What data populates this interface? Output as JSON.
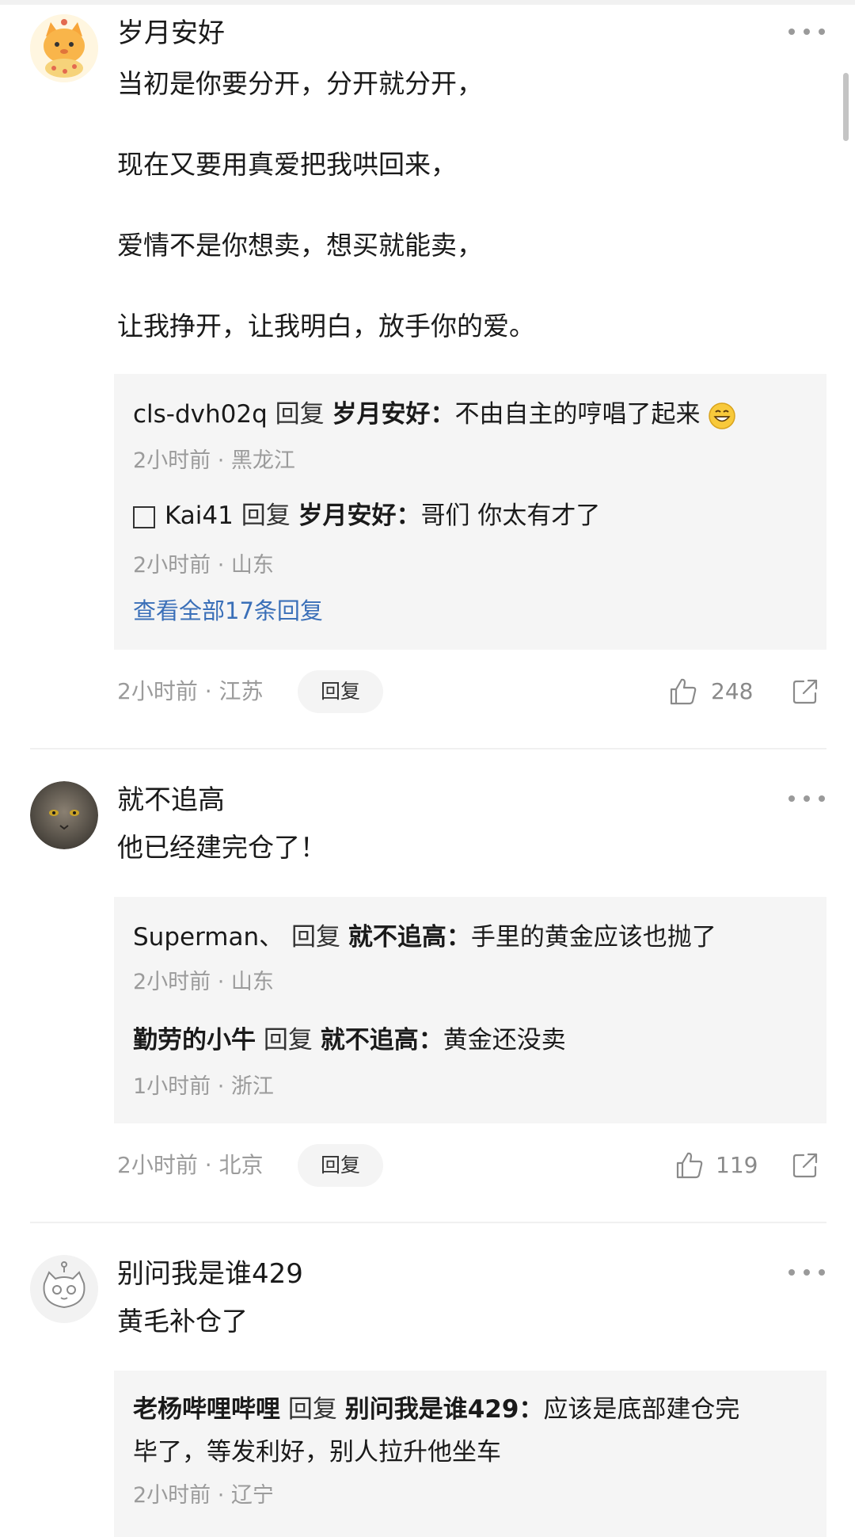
{
  "comments": [
    {
      "user": "岁月安好",
      "lines": [
        "当初是你要分开，分开就分开，",
        "现在又要用真爱把我哄回来，",
        "爱情不是你想卖，想买就能卖，",
        "让我挣开，让我明白，放手你的爱。"
      ],
      "replies": [
        {
          "name": "cls-dvh02q",
          "verb": "回复",
          "target": "岁月安好：",
          "text": "不由自主的哼唱了起来",
          "meta": "2小时前 · 黑龙江",
          "emoji": "grinning-emoji"
        },
        {
          "name": "Kai41",
          "verb": "回复",
          "target": "岁月安好：",
          "text": "哥们 你太有才了",
          "meta": "2小时前 · 山东"
        }
      ],
      "view_all": "查看全部17条回复",
      "meta": "2小时前 · 江苏",
      "reply_label": "回复",
      "likes": "248"
    },
    {
      "user": "就不追高",
      "lines": [
        "他已经建完仓了！"
      ],
      "replies": [
        {
          "name": "Superman、",
          "verb": "回复",
          "target": "就不追高：",
          "text": "手里的黄金应该也抛了",
          "meta": "2小时前 · 山东"
        },
        {
          "name": "勤劳的小牛",
          "verb": "回复",
          "target": "就不追高：",
          "text": "黄金还没卖",
          "meta": "1小时前 · 浙江"
        }
      ],
      "meta": "2小时前 · 北京",
      "reply_label": "回复",
      "likes": "119"
    },
    {
      "user": "别问我是谁429",
      "lines": [
        "黄毛补仓了"
      ],
      "replies": [
        {
          "name": "老杨哔哩哔哩",
          "verb": "回复",
          "target": "别问我是谁429：",
          "text": "应该是底部建仓完",
          "text2": "毕了，等发利好，别人拉升他坐车",
          "meta": "2小时前 · 辽宁"
        }
      ]
    }
  ]
}
